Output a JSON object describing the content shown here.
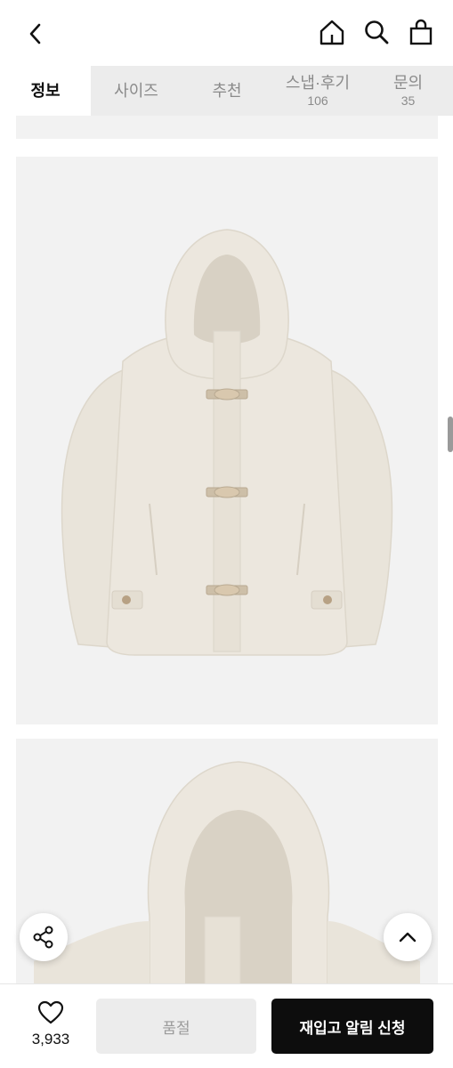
{
  "header": {
    "back_icon": "chevron-left-icon",
    "icons": [
      "home-icon",
      "search-icon",
      "shopping-bag-icon"
    ]
  },
  "tabs": [
    {
      "label": "정보",
      "count": "",
      "active": true
    },
    {
      "label": "사이즈",
      "count": "",
      "active": false
    },
    {
      "label": "추천",
      "count": "",
      "active": false
    },
    {
      "label": "스냅·후기",
      "count": "106",
      "active": false
    },
    {
      "label": "문의",
      "count": "35",
      "active": false
    }
  ],
  "content": {
    "images": [
      "product-image-jacket-front",
      "product-image-hood-closeup"
    ],
    "image_background": "#f2f2f2",
    "jacket_color": "#ebe6dd"
  },
  "floating": {
    "share_icon": "share-icon",
    "scroll_top_icon": "chevron-up-icon"
  },
  "bottom_bar": {
    "like_icon": "heart-icon",
    "like_count": "3,933",
    "soldout_label": "품절",
    "restock_label": "재입고 알림 신청"
  },
  "colors": {
    "tab_bar": "#ececec",
    "primary_button": "#0d0d0d",
    "disabled_button": "#ececec"
  }
}
